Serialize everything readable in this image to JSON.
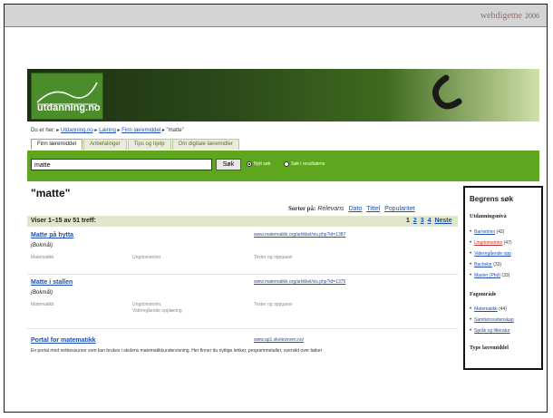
{
  "brand": {
    "prefix": "web",
    "suffix": "digetne",
    "year": "2006"
  },
  "site": {
    "logo_text": "utdanning.no"
  },
  "breadcrumb": {
    "prefix": "Du er her:",
    "items": [
      "Utdanning.no",
      "Læring",
      "Finn læremiddel"
    ],
    "current": "\"matte\""
  },
  "tabs": [
    "Finn læremiddel",
    "Anbefalinger",
    "Tips og hjelp",
    "Om digitale læremidler"
  ],
  "search": {
    "value": "matte",
    "button": "Søk",
    "options": [
      "Nytt søk",
      "Søk i resultatene"
    ]
  },
  "query_title": "\"matte\"",
  "sort": {
    "label": "Sorter på:",
    "current": "Relevans",
    "options": [
      "Dato",
      "Tittel",
      "Popularitet"
    ]
  },
  "results_bar": {
    "count": "Viser 1–15 av 51 treff:",
    "pages": [
      "1",
      "2",
      "3",
      "4"
    ],
    "next": "Neste"
  },
  "results": [
    {
      "title": "Matte på hytta",
      "url": "www.matematikk.org/artikkel/vis.php?id=1387",
      "lang": "(Bokmål)",
      "subject": "Matematikk",
      "level": "Ungdomstrinn",
      "type": "Tester og oppgaver"
    },
    {
      "title": "Matte i stallen",
      "url": "www.matematikk.org/artikkel/vis.php?id=1375",
      "lang": "(Bokmål)",
      "subject": "Matematikk",
      "level": "Ungdomstrinn,",
      "level2": "Videregående opplæring",
      "type": "Tester og oppgaver"
    },
    {
      "title": "Portal for matematikk",
      "url": "www.ap1.skoleveven.no/",
      "desc": "En portal med nettressurser som kan brukes i skolens matematikkundervisning. Her finner du nyttige lenker, programmetaller, oversikt over bøker"
    }
  ],
  "sidebar": {
    "title": "Begrens søk",
    "sections": [
      {
        "heading": "Utdanningsnivå",
        "items": [
          {
            "label": "Barnetrinn",
            "count": "(42)"
          },
          {
            "label": "Ungdomstrinn",
            "count": "(47)"
          },
          {
            "label": "Videregående opp",
            "count": ""
          },
          {
            "label": "Bachelor",
            "count": "(33)"
          },
          {
            "label": "Master (Phd)",
            "count": "(33)"
          }
        ]
      },
      {
        "heading": "Fagområde",
        "items": [
          {
            "label": "Matematikk",
            "count": "(44)"
          },
          {
            "label": "Samfunnsvitenskap",
            "count": ""
          },
          {
            "label": "Språk og litteratur",
            "count": ""
          }
        ]
      },
      {
        "heading": "Type læremiddel",
        "items": []
      }
    ]
  },
  "colors": {
    "green": "#5da61e",
    "dark_green": "#2c4a1a",
    "link": "#1f4fb0"
  }
}
